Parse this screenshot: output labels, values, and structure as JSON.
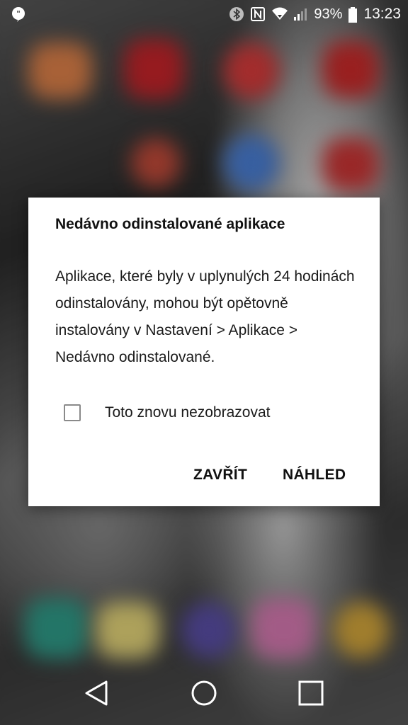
{
  "status_bar": {
    "notification_icon": "hangouts-icon",
    "icons": [
      "bluetooth-icon",
      "nfc-icon",
      "wifi-icon",
      "signal-icon"
    ],
    "battery_percent": "93%",
    "battery_level": 0.93,
    "time": "13:23"
  },
  "dialog": {
    "title": "Nedávno odinstalované aplikace",
    "message": "Aplikace, které byly v uplynulých 24 hodinách odinstalovány, mohou být opětovně instalovány v Nastavení > Aplikace > Nedávno odinstalované.",
    "checkbox_label": "Toto znovu nezobrazovat",
    "checkbox_checked": false,
    "close_button": "ZAVŘÍT",
    "preview_button": "NÁHLED"
  },
  "nav_bar": {
    "icons": [
      "back-icon",
      "home-icon",
      "recents-icon"
    ]
  }
}
